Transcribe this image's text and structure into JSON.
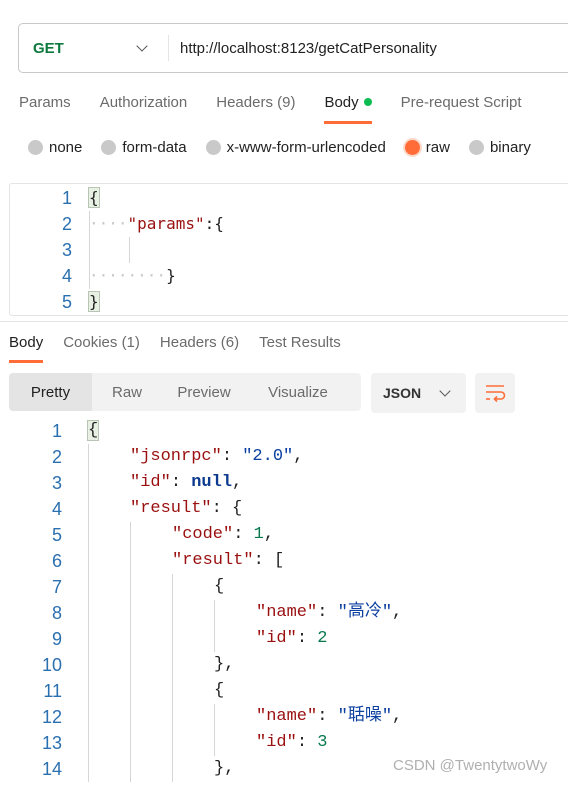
{
  "request": {
    "method": "GET",
    "url": "http://localhost:8123/getCatPersonality",
    "tabs": [
      {
        "label": "Params"
      },
      {
        "label": "Authorization"
      },
      {
        "label": "Headers (9)"
      },
      {
        "label": "Body",
        "active": true,
        "dot": true
      },
      {
        "label": "Pre-request Script"
      }
    ],
    "body_modes": [
      {
        "label": "none"
      },
      {
        "label": "form-data"
      },
      {
        "label": "x-www-form-urlencoded"
      },
      {
        "label": "raw",
        "selected": true
      },
      {
        "label": "binary"
      }
    ],
    "body_lines": [
      {
        "n": "1",
        "indent": 0,
        "tokens": [
          {
            "t": "{",
            "c": "p bhl"
          }
        ]
      },
      {
        "n": "2",
        "indent": 1,
        "dots": "····",
        "tokens": [
          {
            "t": "\"params\"",
            "c": "key"
          },
          {
            "t": ":{",
            "c": "p"
          }
        ]
      },
      {
        "n": "3",
        "indent": 2,
        "tokens": []
      },
      {
        "n": "4",
        "indent": 1,
        "dots": "········",
        "tokens": [
          {
            "t": "}",
            "c": "p"
          }
        ]
      },
      {
        "n": "5",
        "indent": 0,
        "tokens": [
          {
            "t": "}",
            "c": "p bhl"
          }
        ]
      }
    ]
  },
  "response": {
    "tabs": [
      {
        "label": "Body",
        "active": true
      },
      {
        "label": "Cookies (1)"
      },
      {
        "label": "Headers (6)"
      },
      {
        "label": "Test Results"
      }
    ],
    "view_modes": [
      {
        "label": "Pretty",
        "active": true
      },
      {
        "label": "Raw"
      },
      {
        "label": "Preview"
      },
      {
        "label": "Visualize"
      }
    ],
    "format": "JSON",
    "wrap_icon": "wrap-lines-icon",
    "accent": "#ff6c37",
    "lines": [
      {
        "n": "1",
        "indent": 0,
        "tokens": [
          {
            "t": "{",
            "c": "p bhl"
          }
        ]
      },
      {
        "n": "2",
        "indent": 1,
        "tokens": [
          {
            "t": "\"jsonrpc\"",
            "c": "key"
          },
          {
            "t": ": ",
            "c": "p"
          },
          {
            "t": "\"2.0\"",
            "c": "str"
          },
          {
            "t": ",",
            "c": "p"
          }
        ]
      },
      {
        "n": "3",
        "indent": 1,
        "tokens": [
          {
            "t": "\"id\"",
            "c": "key"
          },
          {
            "t": ": ",
            "c": "p"
          },
          {
            "t": "null",
            "c": "kw"
          },
          {
            "t": ",",
            "c": "p"
          }
        ]
      },
      {
        "n": "4",
        "indent": 1,
        "tokens": [
          {
            "t": "\"result\"",
            "c": "key"
          },
          {
            "t": ": {",
            "c": "p"
          }
        ]
      },
      {
        "n": "5",
        "indent": 2,
        "tokens": [
          {
            "t": "\"code\"",
            "c": "key"
          },
          {
            "t": ": ",
            "c": "p"
          },
          {
            "t": "1",
            "c": "numv"
          },
          {
            "t": ",",
            "c": "p"
          }
        ]
      },
      {
        "n": "6",
        "indent": 2,
        "tokens": [
          {
            "t": "\"result\"",
            "c": "key"
          },
          {
            "t": ": [",
            "c": "p"
          }
        ]
      },
      {
        "n": "7",
        "indent": 3,
        "tokens": [
          {
            "t": "{",
            "c": "p"
          }
        ]
      },
      {
        "n": "8",
        "indent": 4,
        "tokens": [
          {
            "t": "\"name\"",
            "c": "key"
          },
          {
            "t": ": ",
            "c": "p"
          },
          {
            "t": "\"高冷\"",
            "c": "str"
          },
          {
            "t": ",",
            "c": "p"
          }
        ]
      },
      {
        "n": "9",
        "indent": 4,
        "tokens": [
          {
            "t": "\"id\"",
            "c": "key"
          },
          {
            "t": ": ",
            "c": "p"
          },
          {
            "t": "2",
            "c": "numv"
          }
        ]
      },
      {
        "n": "10",
        "indent": 3,
        "tokens": [
          {
            "t": "},",
            "c": "p"
          }
        ]
      },
      {
        "n": "11",
        "indent": 3,
        "tokens": [
          {
            "t": "{",
            "c": "p"
          }
        ]
      },
      {
        "n": "12",
        "indent": 4,
        "tokens": [
          {
            "t": "\"name\"",
            "c": "key"
          },
          {
            "t": ": ",
            "c": "p"
          },
          {
            "t": "\"聒噪\"",
            "c": "str"
          },
          {
            "t": ",",
            "c": "p"
          }
        ]
      },
      {
        "n": "13",
        "indent": 4,
        "tokens": [
          {
            "t": "\"id\"",
            "c": "key"
          },
          {
            "t": ": ",
            "c": "p"
          },
          {
            "t": "3",
            "c": "numv"
          }
        ]
      },
      {
        "n": "14",
        "indent": 3,
        "tokens": [
          {
            "t": "},",
            "c": "p"
          }
        ]
      }
    ]
  },
  "watermark": "CSDN @TwentytwoWy"
}
